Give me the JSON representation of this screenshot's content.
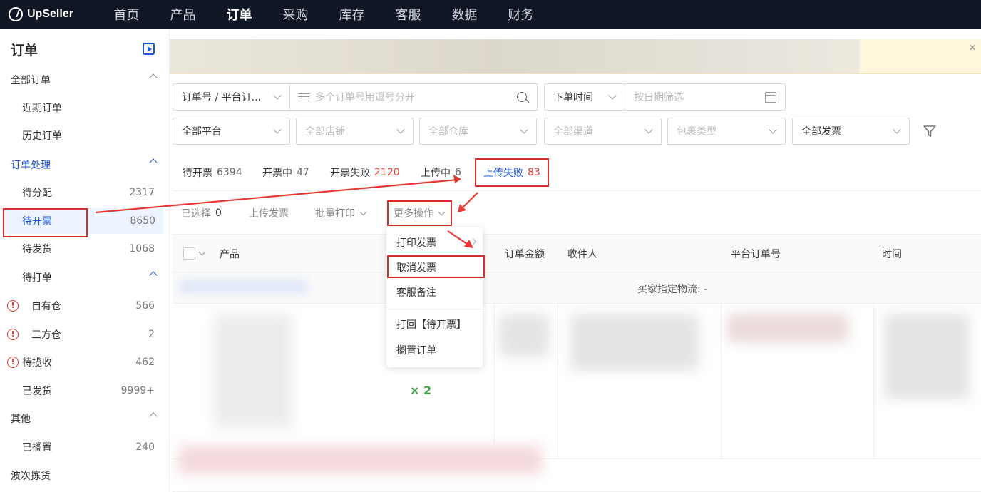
{
  "topbar": {
    "logo_text": "UpSeller",
    "nav": [
      "首页",
      "产品",
      "订单",
      "采购",
      "库存",
      "客服",
      "数据",
      "财务"
    ],
    "active_index": 2
  },
  "sidebar": {
    "title": "订单",
    "rows": [
      {
        "label": "全部订单",
        "count": "",
        "kind": "group"
      },
      {
        "label": "近期订单",
        "count": "",
        "kind": "item"
      },
      {
        "label": "历史订单",
        "count": "",
        "kind": "item"
      },
      {
        "label": "订单处理",
        "count": "",
        "kind": "group-blue"
      },
      {
        "label": "待分配",
        "count": "2317",
        "kind": "item"
      },
      {
        "label": "待开票",
        "count": "8650",
        "kind": "selected"
      },
      {
        "label": "待发货",
        "count": "1068",
        "kind": "item"
      },
      {
        "label": "待打单",
        "count": "",
        "kind": "subgroup"
      },
      {
        "label": "自有仓",
        "count": "566",
        "kind": "warn-sub"
      },
      {
        "label": "三方仓",
        "count": "2",
        "kind": "warn-sub"
      },
      {
        "label": "待揽收",
        "count": "462",
        "kind": "warn"
      },
      {
        "label": "已发货",
        "count": "9999+",
        "kind": "item"
      },
      {
        "label": "其他",
        "count": "",
        "kind": "group"
      },
      {
        "label": "已搁置",
        "count": "240",
        "kind": "item"
      },
      {
        "label": "波次拣货",
        "count": "",
        "kind": "plain"
      }
    ]
  },
  "banner": {
    "close": "×"
  },
  "filters": {
    "order_type": "订单号 / 平台订...",
    "search_placeholder": "多个订单号用逗号分开",
    "time_type": "下单时间",
    "date_placeholder": "按日期筛选",
    "platform": "全部平台",
    "store": "全部店铺",
    "warehouse": "全部仓库",
    "channel": "全部渠道",
    "package_type": "包裹类型",
    "invoice": "全部发票"
  },
  "tabs": [
    {
      "label": "待开票",
      "count": "6394"
    },
    {
      "label": "开票中",
      "count": "47"
    },
    {
      "label": "开票失败",
      "count": "2120"
    },
    {
      "label": "上传中",
      "count": "6"
    },
    {
      "label": "上传失败",
      "count": "83"
    }
  ],
  "toolbar": {
    "selected_label": "已选择",
    "selected_count": "0",
    "upload": "上传发票",
    "batch_print": "批量打印",
    "more": "更多操作"
  },
  "table": {
    "headers": [
      "产品",
      "订单金额",
      "收件人",
      "平台订单号",
      "时间"
    ],
    "logistics": "买家指定物流: -",
    "qty": "× 2"
  },
  "dropdown": {
    "items": [
      "打印发票",
      "取消发票",
      "客服备注",
      "打回【待开票】",
      "搁置订单"
    ]
  },
  "colors": {
    "accent": "#1a56db",
    "highlight": "#d32f2f",
    "topbar": "#0f1724"
  }
}
